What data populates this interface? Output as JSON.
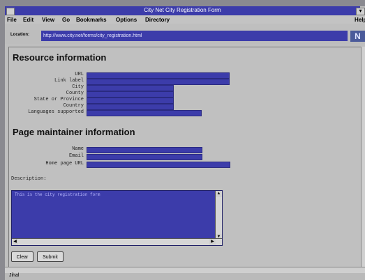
{
  "window": {
    "title": "City Net City Registration Form",
    "help_fragment": "Help"
  },
  "menu": [
    "File",
    "Edit",
    "View",
    "Go",
    "Bookmarks",
    "Options",
    "Directory"
  ],
  "location": {
    "label": "Location:",
    "url": "http://www.city.net/forms/city_registration.html"
  },
  "resource": {
    "heading": "Resource information",
    "fields": [
      {
        "label": "URL",
        "name": "url-field"
      },
      {
        "label": "Link label",
        "name": "link-label-field"
      },
      {
        "label": "City",
        "name": "city-field"
      },
      {
        "label": "County",
        "name": "county-field"
      },
      {
        "label": "State or Province",
        "name": "state-field"
      },
      {
        "label": "Country",
        "name": "country-field"
      },
      {
        "label": "Languages supported",
        "name": "languages-field"
      }
    ]
  },
  "maintainer": {
    "heading": "Page maintainer information",
    "fields": [
      {
        "label": "Name",
        "name": "name-field"
      },
      {
        "label": "Email",
        "name": "email-field"
      },
      {
        "label": "Home page URL",
        "name": "homepage-field"
      }
    ]
  },
  "description": {
    "label": "Description:",
    "value": "This is the city registration form"
  },
  "buttons": {
    "clear": "Clear",
    "submit": "Submit"
  },
  "status": "Jihal",
  "icons": {
    "logo": "N"
  }
}
